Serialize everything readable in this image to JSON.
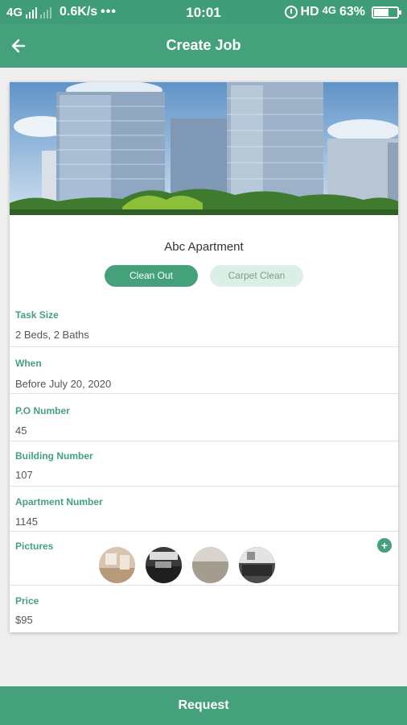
{
  "status_bar": {
    "network": "4G",
    "speed": "0.6K/s",
    "dots": "•••",
    "time": "10:01",
    "hd": "HD",
    "network2": "4G",
    "battery": "63%",
    "battery_level": 0.63
  },
  "header": {
    "title": "Create Job",
    "back_icon": "arrow-left-icon"
  },
  "job": {
    "building_name": "Abc Apartment",
    "services": [
      {
        "label": "Clean Out",
        "selected": true
      },
      {
        "label": "Carpet Clean",
        "selected": false
      }
    ]
  },
  "fields": {
    "task_size": {
      "label": "Task Size",
      "value": "2 Beds,  2 Baths"
    },
    "when": {
      "label": "When",
      "value": "Before July 20, 2020"
    },
    "po_number": {
      "label": "P.O Number",
      "value": "45"
    },
    "building_number": {
      "label": "Building Number",
      "value": "107"
    },
    "apartment_number": {
      "label": "Apartment Number",
      "value": "1145"
    },
    "pictures": {
      "label": "Pictures",
      "add_icon": "plus-icon",
      "add_symbol": "+"
    },
    "price": {
      "label": "Price",
      "value": "$95"
    }
  },
  "footer": {
    "request_label": "Request"
  },
  "colors": {
    "primary": "#45a07c",
    "status": "#3f9e79",
    "chip_inactive": "#dcefe6",
    "label": "#45a07c"
  }
}
